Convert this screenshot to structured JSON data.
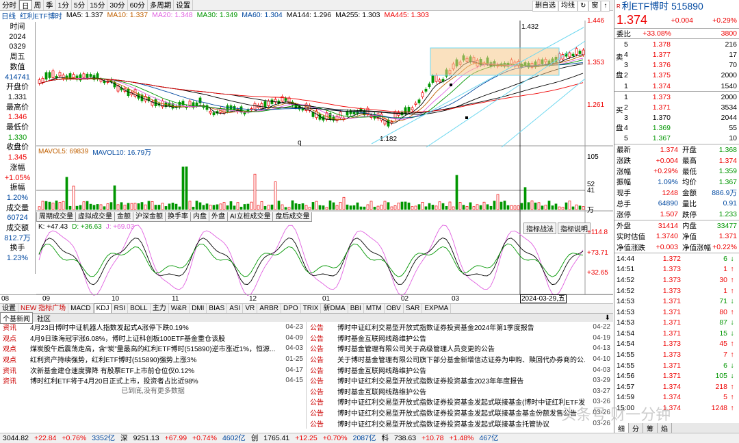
{
  "toolbar": {
    "tabs": [
      "分时",
      "日",
      "周",
      "季",
      "1分",
      "5分",
      "15分",
      "30分",
      "60分",
      "多周期",
      "设置"
    ],
    "right": [
      "删自选",
      "均线",
      "↻",
      "窗",
      "↑"
    ]
  },
  "ma_line": [
    {
      "t": "日线",
      "c": "#0048a0"
    },
    {
      "t": "红利ETF博时",
      "c": "#0048a0"
    },
    {
      "t": "MA5: 1.337",
      "c": "#000"
    },
    {
      "t": "MA10: 1.337",
      "c": "#c06000"
    },
    {
      "t": "MA20: 1.348",
      "c": "#e060e0"
    },
    {
      "t": "MA30: 1.349",
      "c": "#009600"
    },
    {
      "t": "MA60: 1.304",
      "c": "#0048a0"
    },
    {
      "t": "MA144: 1.296",
      "c": "#000"
    },
    {
      "t": "MA255: 1.303",
      "c": "#000"
    },
    {
      "t": "MA445: 1.303",
      "c": "#e00"
    }
  ],
  "left_panel": [
    {
      "t": "时间",
      "c": ""
    },
    {
      "t": "2024",
      "c": ""
    },
    {
      "t": "0329",
      "c": ""
    },
    {
      "t": "周五",
      "c": ""
    },
    {
      "t": "数值",
      "c": ""
    },
    {
      "t": "414741",
      "c": "blu"
    },
    {
      "t": "开盘价",
      "c": ""
    },
    {
      "t": "1.331",
      "c": ""
    },
    {
      "t": "最高价",
      "c": ""
    },
    {
      "t": "1.346",
      "c": "red"
    },
    {
      "t": "最低价",
      "c": ""
    },
    {
      "t": "1.330",
      "c": "grn"
    },
    {
      "t": "收盘价",
      "c": ""
    },
    {
      "t": "1.345",
      "c": "red"
    },
    {
      "t": "涨幅",
      "c": ""
    },
    {
      "t": "+1.05%",
      "c": "red"
    },
    {
      "t": "振幅",
      "c": ""
    },
    {
      "t": "1.20%",
      "c": "blu"
    },
    {
      "t": "成交量",
      "c": ""
    },
    {
      "t": "60724",
      "c": "blu"
    },
    {
      "t": "成交额",
      "c": ""
    },
    {
      "t": "812.7万",
      "c": "blu"
    },
    {
      "t": "换手",
      "c": ""
    },
    {
      "t": "1.23%",
      "c": "blu"
    }
  ],
  "price_axis": [
    "1.446",
    "1.353",
    "1.261"
  ],
  "chart_labels": {
    "high": "1.432",
    "low": "1.182",
    "q": "q"
  },
  "vol_header": [
    {
      "t": "MAVOL5: 69839",
      "c": "#c06000"
    },
    {
      "t": "MAVOL10: 16.79万",
      "c": "#0048a0"
    }
  ],
  "vol_axis": [
    "105",
    "52",
    "41",
    "万"
  ],
  "ind_tabs": [
    "周期成交量",
    "虚拟成交量",
    "金额",
    "沪深金额",
    "换手率",
    "内盘",
    "外盘",
    "AI立桩成交量",
    "盘后成交量"
  ],
  "kdj_header": [
    {
      "t": "K: +47.43",
      "c": "#000"
    },
    {
      "t": "D: +36.63",
      "c": "#009600"
    },
    {
      "t": "J: +69.03",
      "c": "#e060e0"
    }
  ],
  "kdj_axis": [
    "+114.8",
    "+73.71",
    "+32.65"
  ],
  "kdj_buttons": [
    "指标战法",
    "指标说明"
  ],
  "date_axis": [
    "08",
    "09",
    "10",
    "11",
    "12",
    "01",
    "02",
    "03"
  ],
  "date_cursor": "2024-03-29,五",
  "ind_bar": [
    "设置",
    "NEW 指标广场",
    "MACD",
    "KDJ",
    "RSI",
    "BOLL",
    "主力",
    "W&R",
    "DMI",
    "BIAS",
    "ASI",
    "VR",
    "ARBR",
    "DPO",
    "TRIX",
    "新DMA",
    "BBI",
    "MTM",
    "OBV",
    "SAR",
    "EXPMA"
  ],
  "news_tabs": [
    "个基新闻",
    "社区"
  ],
  "news_left": [
    {
      "tag": "资讯",
      "title": "4月23日博时中证机器人指数发起式A涨停下跌0.19%",
      "date": "04-23"
    },
    {
      "tag": "观点",
      "title": "4月9日珠海冠宇涨6.08%，博时上证科创板100ETF基金重仓该股",
      "date": "04-09"
    },
    {
      "tag": "观点",
      "title": "煤炭股午后震荡走高，含“炭”量最高的红利ETF博时(515890)逆市涨近1%，恒源...",
      "date": "04-03"
    },
    {
      "tag": "观点",
      "title": "红利资产持续强势，红利ETF博时(515890)强势上涨3%",
      "date": "01-25"
    },
    {
      "tag": "资讯",
      "title": "次新基金建仓速度骤降 有股票ETF上市前仓位仅0.12%",
      "date": "04-17"
    },
    {
      "tag": "资讯",
      "title": "博时红利ETF将于4月20日正式上市，投资者占比近98%",
      "date": "04-15"
    }
  ],
  "news_left_footer": "已到底,没有更多数据",
  "news_right": [
    {
      "tag": "公告",
      "title": "博时中证红利交易型开放式指数证券投资基金2024年第1季度报告",
      "date": "04-22"
    },
    {
      "tag": "公告",
      "title": "博时基金互联网线路维护公告",
      "date": "04-19"
    },
    {
      "tag": "公告",
      "title": "博时基金管理有限公司关于高级管理人员变更的公告",
      "date": "04-13"
    },
    {
      "tag": "公告",
      "title": "关于博时基金管理有限公司旗下部分基金新增信达证券为申购、赎回代办券商的公...",
      "date": "04-10"
    },
    {
      "tag": "公告",
      "title": "博时基金互联网线路维护公告",
      "date": "04-03"
    },
    {
      "tag": "公告",
      "title": "博时中证红利交易型开放式指数证券投资基金2023年年度报告",
      "date": "03-29"
    },
    {
      "tag": "公告",
      "title": "博时基金互联网线路维护公告",
      "date": "03-27"
    },
    {
      "tag": "公告",
      "title": "博时中证红利交易型开放式指数证券投资基金发起式联接基金(博时中证红利ETF发...",
      "date": "03-26"
    },
    {
      "tag": "公告",
      "title": "博时中证红利交易型开放式指数证券投资基金发起式联接基金基金份额发售公告",
      "date": "03-26"
    },
    {
      "tag": "公告",
      "title": "博时中证红利交易型开放式指数证券投资基金发起式联接基金托管协议",
      "date": "03-26"
    }
  ],
  "status": [
    {
      "t": "3044.82",
      "c": "#000"
    },
    {
      "t": "+22.84",
      "c": "#e00"
    },
    {
      "t": "+0.76%",
      "c": "#e00"
    },
    {
      "t": "3352亿",
      "c": "#0048a0"
    },
    {
      "t": "深",
      "c": "#000"
    },
    {
      "t": "9251.13",
      "c": "#000"
    },
    {
      "t": "+67.99",
      "c": "#e00"
    },
    {
      "t": "+0.74%",
      "c": "#e00"
    },
    {
      "t": "4602亿",
      "c": "#0048a0"
    },
    {
      "t": "创",
      "c": "#000"
    },
    {
      "t": "1765.41",
      "c": "#000"
    },
    {
      "t": "+12.25",
      "c": "#e00"
    },
    {
      "t": "+0.70%",
      "c": "#e00"
    },
    {
      "t": "2087亿",
      "c": "#0048a0"
    },
    {
      "t": "科",
      "c": "#000"
    },
    {
      "t": "738.63",
      "c": "#000"
    },
    {
      "t": "+10.78",
      "c": "#e00"
    },
    {
      "t": "+1.48%",
      "c": "#e00"
    },
    {
      "t": "467亿",
      "c": "#0048a0"
    }
  ],
  "quote": {
    "code_title": "利ETF博时 515890",
    "r_badge": "R",
    "price": "1.374",
    "change": "+0.004",
    "pct": "+0.29%",
    "webi": {
      "k1": "委比",
      "v1": "+33.08%",
      "k2": "",
      "v2": "3800"
    },
    "sell": [
      {
        "n": "5",
        "p": "1.378",
        "v": "216"
      },
      {
        "n": "4",
        "p": "1.377",
        "v": "17"
      },
      {
        "n": "3",
        "p": "1.376",
        "v": "70"
      },
      {
        "n": "2",
        "p": "1.375",
        "v": "2000"
      },
      {
        "n": "1",
        "p": "1.374",
        "v": "1540"
      }
    ],
    "buy": [
      {
        "n": "1",
        "p": "1.373",
        "v": "2000"
      },
      {
        "n": "2",
        "p": "1.371",
        "v": "3534"
      },
      {
        "n": "3",
        "p": "1.370",
        "v": "2044"
      },
      {
        "n": "4",
        "p": "1.369",
        "v": "55"
      },
      {
        "n": "5",
        "p": "1.367",
        "v": "10"
      }
    ],
    "sell_label": "卖盘",
    "buy_label": "买盘",
    "stats": [
      {
        "k": "最新",
        "v": "1.374",
        "vc": "red",
        "k2": "开盘",
        "v2": "1.368",
        "v2c": "grn"
      },
      {
        "k": "涨跌",
        "v": "+0.004",
        "vc": "red",
        "k2": "最高",
        "v2": "1.374",
        "v2c": "red"
      },
      {
        "k": "涨幅",
        "v": "+0.29%",
        "vc": "red",
        "k2": "最低",
        "v2": "1.359",
        "v2c": "grn"
      },
      {
        "k": "振幅",
        "v": "1.09%",
        "vc": "blu",
        "k2": "均价",
        "v2": "1.367",
        "v2c": "grn"
      },
      {
        "k": "现手",
        "v": "1248",
        "vc": "red",
        "k2": "金额",
        "v2": "886.9万",
        "v2c": "blu"
      },
      {
        "k": "总手",
        "v": "64890",
        "vc": "blu",
        "k2": "量比",
        "v2": "0.91",
        "v2c": "blu"
      },
      {
        "k": "涨停",
        "v": "1.507",
        "vc": "red",
        "k2": "跌停",
        "v2": "1.233",
        "v2c": "grn"
      }
    ],
    "stats2": [
      {
        "k": "外盘",
        "v": "31414",
        "vc": "red",
        "k2": "内盘",
        "v2": "33477",
        "v2c": "grn"
      },
      {
        "k": "实时估值",
        "v": "1.3740",
        "vc": "red",
        "k2": "净值",
        "v2": "1.371",
        "v2c": "red"
      },
      {
        "k": "净值涨跌",
        "v": "+0.003",
        "vc": "red",
        "k2": "净值涨幅",
        "v2": "+0.22%",
        "v2c": "red"
      }
    ],
    "ticks": [
      {
        "t": "14:44",
        "p": "1.372",
        "n": "6",
        "a": "down"
      },
      {
        "t": "14:51",
        "p": "1.373",
        "n": "1",
        "a": "up"
      },
      {
        "t": "14:52",
        "p": "1.373",
        "n": "30",
        "a": "up"
      },
      {
        "t": "14:52",
        "p": "1.373",
        "n": "1",
        "a": "up"
      },
      {
        "t": "14:53",
        "p": "1.371",
        "n": "71",
        "a": "down"
      },
      {
        "t": "14:53",
        "p": "1.371",
        "n": "80",
        "a": "up"
      },
      {
        "t": "14:53",
        "p": "1.371",
        "n": "87",
        "a": "down"
      },
      {
        "t": "14:54",
        "p": "1.371",
        "n": "15",
        "a": "down"
      },
      {
        "t": "14:54",
        "p": "1.373",
        "n": "45",
        "a": "up"
      },
      {
        "t": "14:55",
        "p": "1.373",
        "n": "7",
        "a": "up"
      },
      {
        "t": "14:55",
        "p": "1.371",
        "n": "6",
        "a": "down"
      },
      {
        "t": "14:56",
        "p": "1.371",
        "n": "105",
        "a": "down"
      },
      {
        "t": "14:57",
        "p": "1.374",
        "n": "218",
        "a": "up"
      },
      {
        "t": "14:59",
        "p": "1.374",
        "n": "5",
        "a": "up"
      },
      {
        "t": "15:00",
        "p": "1.374",
        "n": "1248",
        "a": "up"
      }
    ],
    "bottom_tabs": [
      "细",
      "分",
      "筹",
      "焰"
    ]
  },
  "watermark": "头条号 财一分钟",
  "chart_data": [
    {
      "type": "candlestick",
      "title": "",
      "series": [
        {
          "name": "MA5",
          "values": []
        },
        {
          "name": "MA10",
          "values": []
        }
      ],
      "ylim": [
        1.182,
        1.446
      ],
      "yticks": [
        1.446,
        1.353,
        1.261
      ],
      "annotations": [
        "1.432",
        "1.182"
      ],
      "x": [
        "08",
        "09",
        "10",
        "11",
        "12",
        "01",
        "02",
        "03"
      ]
    },
    {
      "type": "bar",
      "title": "",
      "series": [
        {
          "name": "MAVOL5",
          "values": []
        },
        {
          "name": "MAVOL10",
          "values": []
        }
      ],
      "yticks": [
        105,
        52,
        41
      ]
    },
    {
      "type": "line",
      "title": "",
      "series": [
        {
          "name": "K",
          "values": []
        },
        {
          "name": "D",
          "values": []
        },
        {
          "name": "J",
          "values": []
        }
      ],
      "yticks": [
        114.8,
        73.71,
        32.65
      ]
    }
  ]
}
